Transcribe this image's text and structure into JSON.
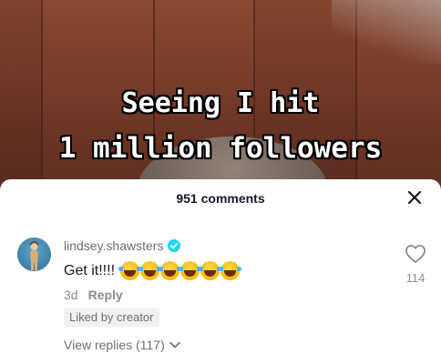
{
  "video": {
    "caption_line1": "Seeing I hit",
    "caption_line2": "1 million followers"
  },
  "comments_panel": {
    "title": "951 comments",
    "close_icon": "close-icon"
  },
  "comment": {
    "username": "lindsey.shawsters",
    "verified_icon": "verified-check-icon",
    "text": "Get it!!!!",
    "emoji_icon": "face-with-tears-of-joy-icon",
    "emoji_count": 6,
    "time": "3d",
    "reply_label": "Reply",
    "badge": "Liked by creator",
    "view_replies_label": "View replies (117)",
    "like_count": "114"
  },
  "colors": {
    "verified": "#20d5ec",
    "text_primary": "#161823",
    "text_secondary": "#8a8b91"
  }
}
